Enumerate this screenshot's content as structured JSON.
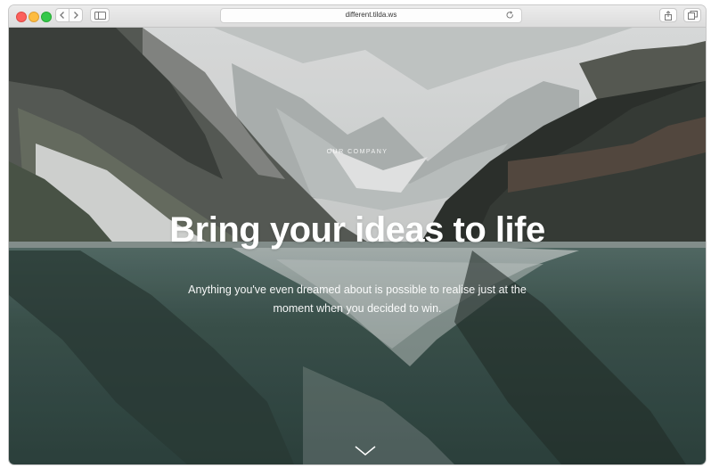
{
  "browser": {
    "url": "different.tilda.ws",
    "back_icon": "chevron-left-icon",
    "forward_icon": "chevron-right-icon",
    "sidebar_icon": "sidebar-icon",
    "reload_icon": "reload-icon",
    "share_icon": "share-icon",
    "tabs_icon": "tabs-icon"
  },
  "hero": {
    "eyebrow": "OUR COMPANY",
    "headline": "Bring your ideas to life",
    "subtitle": "Anything you've even dreamed about is possible to realise just at the moment when you decided to win.",
    "scroll_icon": "chevron-down-icon"
  },
  "colors": {
    "close": "#fc605c",
    "minimize": "#fdbc40",
    "zoom": "#34c84a",
    "lake": "#3e5650",
    "sky": "#e4e6e6"
  }
}
